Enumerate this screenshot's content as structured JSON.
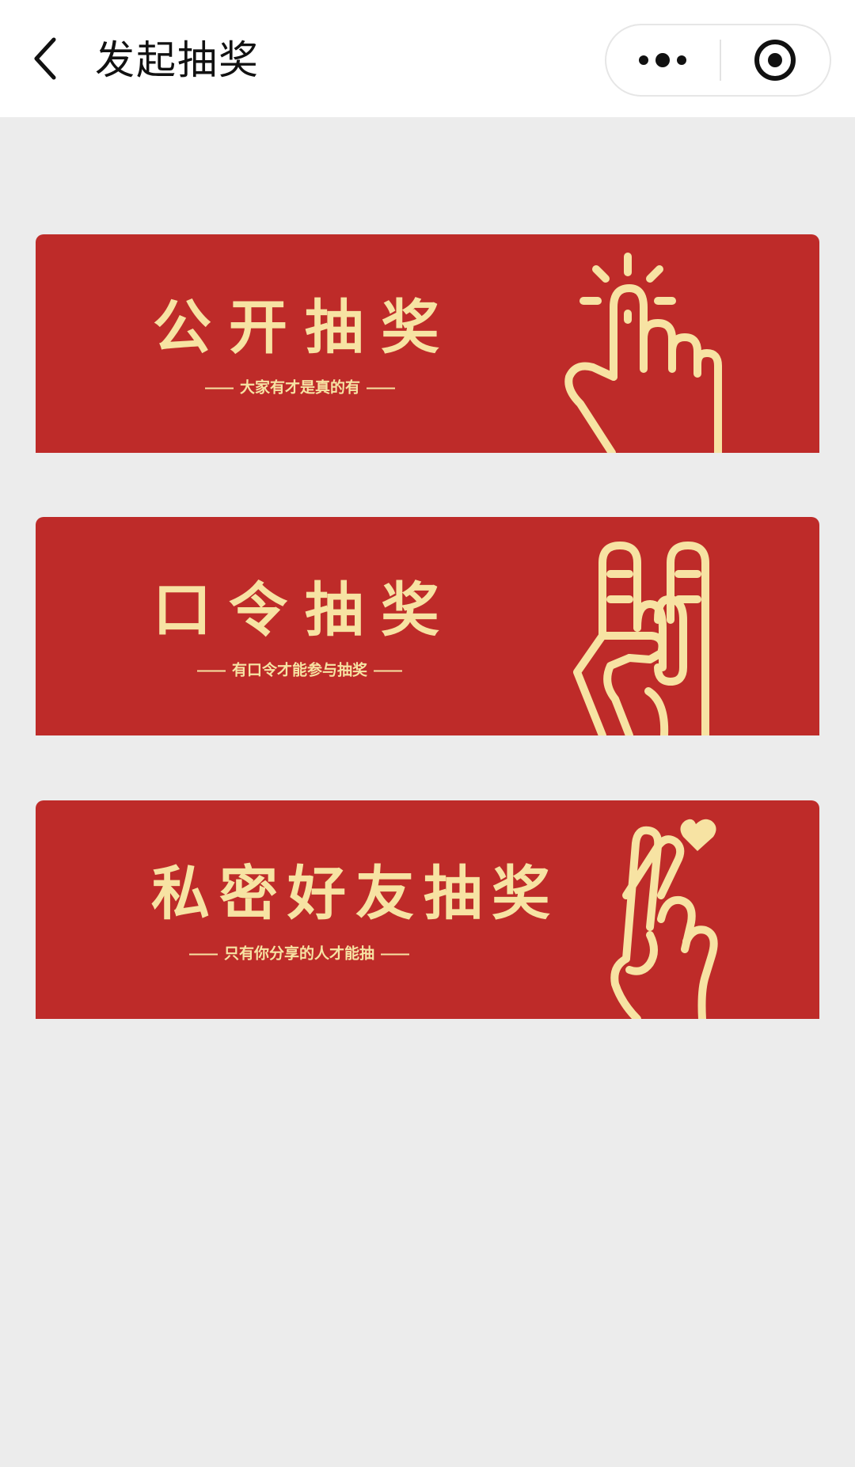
{
  "navbar": {
    "title": "发起抽奖",
    "back_icon": "chevron-left-icon",
    "more_icon": "more-dots-icon",
    "close_icon": "target-icon"
  },
  "colors": {
    "card_background": "#be2b29",
    "card_text": "#f7e3a3",
    "page_background": "#ececec"
  },
  "cards": [
    {
      "title": "公开抽奖",
      "subtitle": "大家有才是真的有",
      "icon": "pointing-finger-icon"
    },
    {
      "title": "口令抽奖",
      "subtitle": "有口令才能参与抽奖",
      "icon": "rock-hand-icon"
    },
    {
      "title": "私密好友抽奖",
      "subtitle": "只有你分享的人才能抽",
      "icon": "finger-heart-icon"
    }
  ]
}
